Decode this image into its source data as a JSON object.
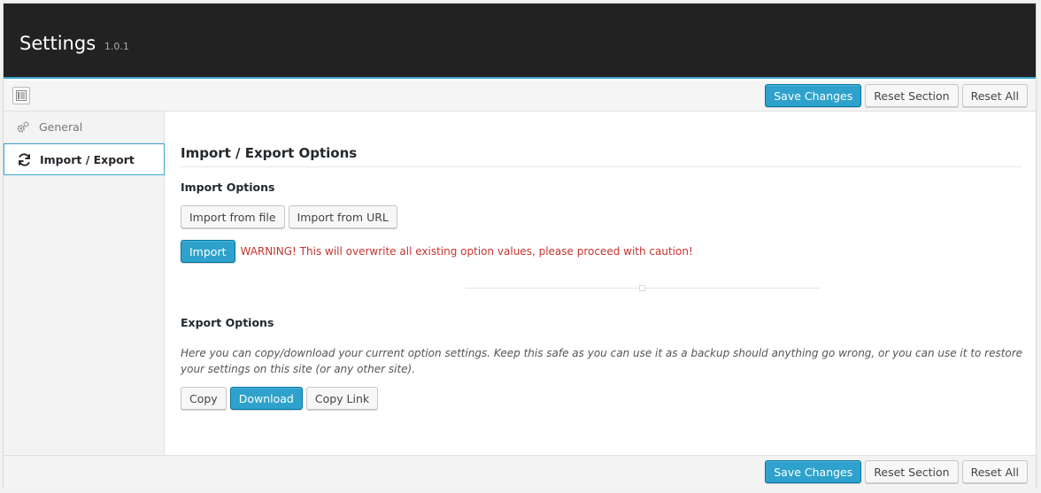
{
  "header": {
    "title": "Settings",
    "version": "1.0.1"
  },
  "toolbar": {
    "expand_icon": "expand-icon",
    "save_label": "Save Changes",
    "reset_section_label": "Reset Section",
    "reset_all_label": "Reset All"
  },
  "sidebar": {
    "items": [
      {
        "label": "General",
        "icon": "gears-icon"
      },
      {
        "label": "Import / Export",
        "icon": "refresh-icon"
      }
    ]
  },
  "main": {
    "section_title": "Import / Export Options",
    "import": {
      "heading": "Import Options",
      "from_file_label": "Import from file",
      "from_url_label": "Import from URL",
      "import_label": "Import",
      "warning": "WARNING! This will overwrite all existing option values, please proceed with caution!"
    },
    "export": {
      "heading": "Export Options",
      "description": "Here you can copy/download your current option settings. Keep this safe as you can use it as a backup should anything go wrong, or you can use it to restore your settings on this site (or any other site).",
      "copy_label": "Copy",
      "download_label": "Download",
      "copy_link_label": "Copy Link"
    }
  },
  "colors": {
    "header_bg": "#222222",
    "accent": "#2ea2cc",
    "warning": "#c43530"
  }
}
